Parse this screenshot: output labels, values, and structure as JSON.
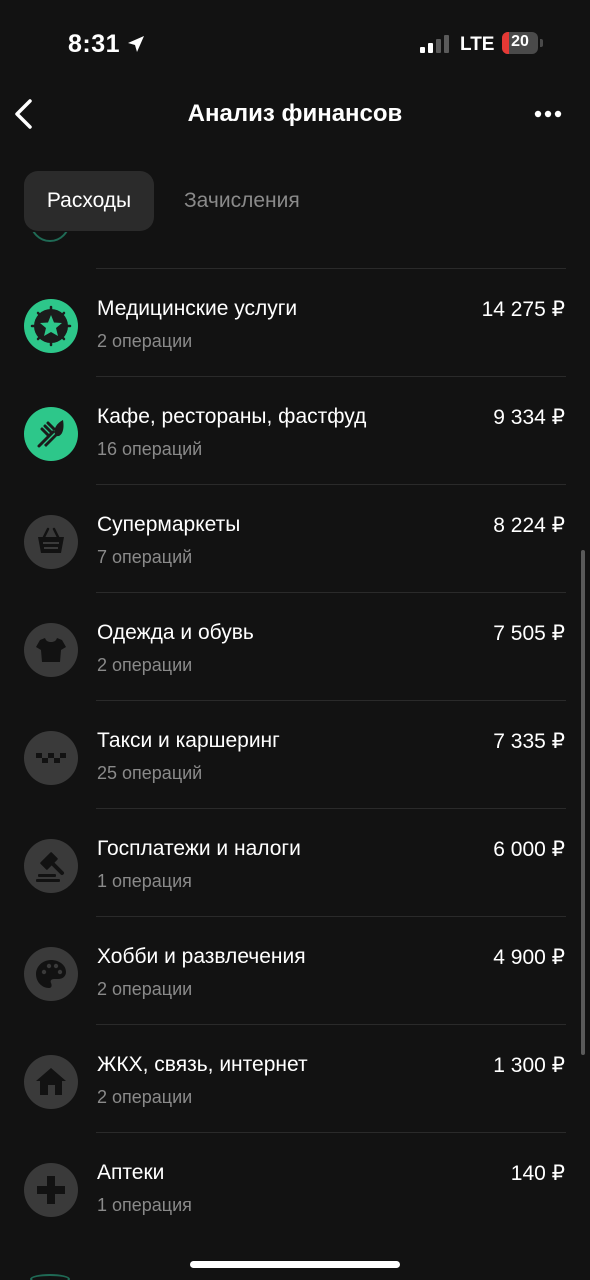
{
  "status_bar": {
    "time": "8:31",
    "network": "LTE",
    "battery": "20",
    "battery_color": "#e53935"
  },
  "nav": {
    "title": "Анализ финансов"
  },
  "tabs": [
    {
      "label": "Расходы",
      "active": true
    },
    {
      "label": "Зачисления",
      "active": false
    }
  ],
  "categories": [
    {
      "title": "Медицинские услуги",
      "subtitle": "2 операции",
      "amount": "14 275 ₽",
      "icon": "star-icon",
      "icon_color": "#2dc78a"
    },
    {
      "title": "Кафе, рестораны, фастфуд",
      "subtitle": "16 операций",
      "amount": "9 334 ₽",
      "icon": "fork-knife-icon",
      "icon_color": "#2dc78a"
    },
    {
      "title": "Супермаркеты",
      "subtitle": "7 операций",
      "amount": "8 224 ₽",
      "icon": "basket-icon",
      "icon_color": "#3a3a3a"
    },
    {
      "title": "Одежда и обувь",
      "subtitle": "2 операции",
      "amount": "7 505 ₽",
      "icon": "tshirt-icon",
      "icon_color": "#3a3a3a"
    },
    {
      "title": "Такси и каршеринг",
      "subtitle": "25 операций",
      "amount": "7 335 ₽",
      "icon": "taxi-checker-icon",
      "icon_color": "#3a3a3a"
    },
    {
      "title": "Госплатежи и налоги",
      "subtitle": "1 операция",
      "amount": "6 000 ₽",
      "icon": "gavel-icon",
      "icon_color": "#3a3a3a"
    },
    {
      "title": "Хобби и развлечения",
      "subtitle": "2 операции",
      "amount": "4 900 ₽",
      "icon": "palette-icon",
      "icon_color": "#3a3a3a"
    },
    {
      "title": "ЖКХ, связь, интернет",
      "subtitle": "2 операции",
      "amount": "1 300 ₽",
      "icon": "house-icon",
      "icon_color": "#3a3a3a"
    },
    {
      "title": "Аптеки",
      "subtitle": "1 операция",
      "amount": "140 ₽",
      "icon": "plus-cross-icon",
      "icon_color": "#3a3a3a"
    }
  ]
}
